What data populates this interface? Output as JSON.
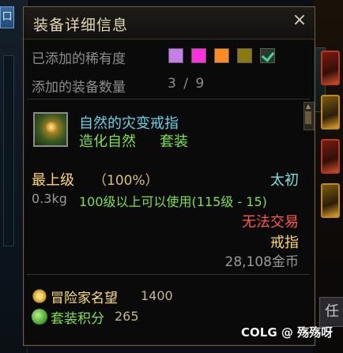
{
  "window": {
    "title": "装备详细信息",
    "close_label": "×"
  },
  "filters": {
    "rarity_label": "已添加的稀有度",
    "rarity_colors": [
      "#c87ee8",
      "#ff30e0",
      "#ff8a20",
      "#8a7a10"
    ],
    "count_label": "添加的装备数量",
    "count_value": "3 / 9"
  },
  "item": {
    "icon": "ring-icon",
    "name": "自然的灾变戒指",
    "set_name": "造化自然",
    "set_tag": "套装",
    "grade_label": "最上级",
    "grade_pct": "（100%）",
    "tier": "太初",
    "weight": "0.3kg",
    "requirement": "100级以上可以使用(115级 - 15)",
    "trade_status": "无法交易",
    "slot_type": "戒指",
    "price": "28,108金币",
    "colors": {
      "name": "#68d3e8",
      "set": "#7fe14a",
      "grade": "#ffd86a",
      "tier": "#7fe0e0",
      "trade": "#ff5a4a"
    }
  },
  "stats": {
    "reputation_label": "冒险家名望",
    "reputation_value": "1400",
    "set_points_label": "套装积分",
    "set_points_value": "265"
  },
  "background": {
    "left_chip": "口",
    "right_tab": "任"
  },
  "watermark": "COLG @ 殇殇呀"
}
